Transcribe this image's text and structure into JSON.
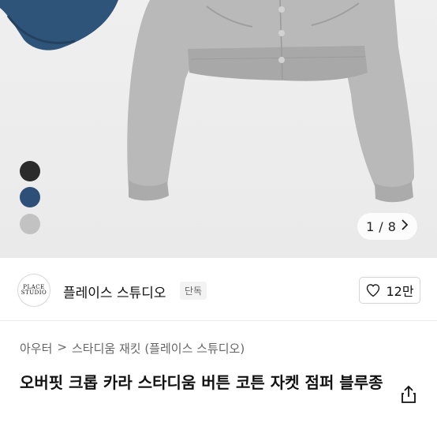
{
  "gallery": {
    "pager_current": "1",
    "pager_total": "8",
    "pager_sep": "/",
    "swatches": [
      {
        "name": "black",
        "color": "#2b2b2b"
      },
      {
        "name": "blue",
        "color": "#2e4f78"
      },
      {
        "name": "gray",
        "color": "#c2c2c2"
      }
    ]
  },
  "brand": {
    "logo_text": "PLACE\nSTUDIO",
    "name": "플레이스 스튜디오",
    "tag": "단독",
    "like_count": "12만"
  },
  "breadcrumb": [
    "아우터",
    "스타디움 재킷 (플레이스 스튜디오)"
  ],
  "breadcrumb_sep": ">",
  "product": {
    "title": "오버핏 크롭 카라 스타디움 버튼 코튼 자켓 점퍼 블루종"
  }
}
